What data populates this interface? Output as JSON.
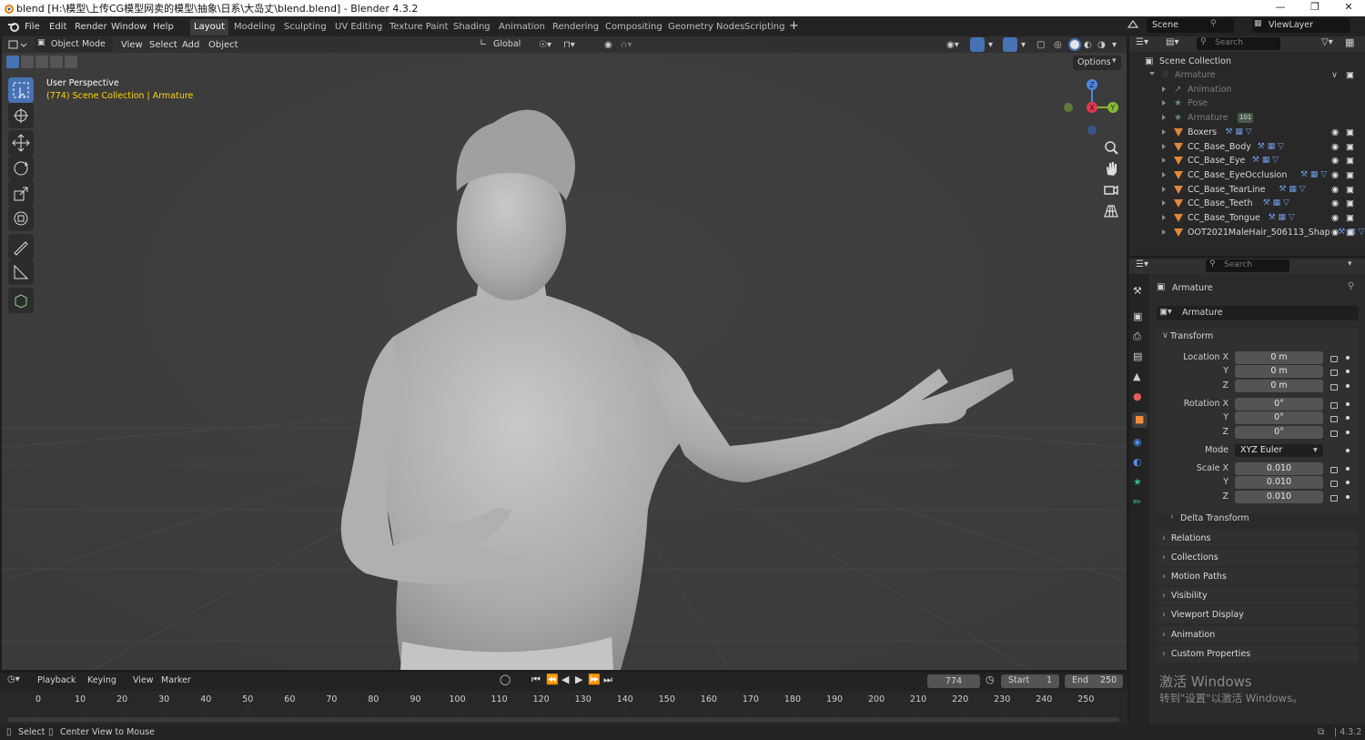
{
  "titlebar": {
    "title": "blend [H:\\模型\\上传CG模型网卖的模型\\抽象\\日系\\大岛丈\\blend.blend] - Blender 4.3.2"
  },
  "menubar": {
    "items": [
      "File",
      "Edit",
      "Render",
      "Window",
      "Help"
    ]
  },
  "workspaces": [
    "Layout",
    "Modeling",
    "Sculpting",
    "UV Editing",
    "Texture Paint",
    "Shading",
    "Animation",
    "Rendering",
    "Compositing",
    "Geometry Nodes",
    "Scripting"
  ],
  "active_workspace": "Layout",
  "scene": {
    "name": "Scene",
    "view_layer": "ViewLayer"
  },
  "viewport": {
    "mode": "Object Mode",
    "menus": [
      "View",
      "Select",
      "Add",
      "Object"
    ],
    "orientation": "Global",
    "options_label": "Options",
    "overlay_title": "User Perspective",
    "overlay_sub": "(774) Scene Collection | Armature",
    "gizmo": {
      "x": "X",
      "y": "Y",
      "z": "Z"
    }
  },
  "outliner": {
    "search_placeholder": "Search",
    "root": "Scene Collection",
    "items": [
      {
        "name": "Armature",
        "level": 1,
        "kind": "armature",
        "dim": true
      },
      {
        "name": "Animation",
        "level": 2,
        "kind": "action",
        "dim": true
      },
      {
        "name": "Pose",
        "level": 2,
        "kind": "pose",
        "dim": true
      },
      {
        "name": "Armature",
        "level": 2,
        "kind": "armdata",
        "dim": true,
        "badge": "101"
      },
      {
        "name": "Boxers",
        "level": 2,
        "kind": "mesh",
        "dim": false
      },
      {
        "name": "CC_Base_Body",
        "level": 2,
        "kind": "mesh",
        "dim": false
      },
      {
        "name": "CC_Base_Eye",
        "level": 2,
        "kind": "mesh",
        "dim": false
      },
      {
        "name": "CC_Base_EyeOcclusion",
        "level": 2,
        "kind": "mesh",
        "dim": false
      },
      {
        "name": "CC_Base_TearLine",
        "level": 2,
        "kind": "mesh",
        "dim": false
      },
      {
        "name": "CC_Base_Teeth",
        "level": 2,
        "kind": "mesh",
        "dim": false
      },
      {
        "name": "CC_Base_Tongue",
        "level": 2,
        "kind": "mesh",
        "dim": false
      },
      {
        "name": "OOT2021MaleHair_506113_Shap",
        "level": 2,
        "kind": "mesh",
        "dim": false
      }
    ]
  },
  "properties": {
    "search_placeholder": "Search",
    "object_name": "Armature",
    "datablock_name": "Armature",
    "transform_label": "Transform",
    "location": {
      "label": "Location X",
      "x": "0 m",
      "y": "0 m",
      "z": "0 m"
    },
    "rotation": {
      "label": "Rotation X",
      "x": "0°",
      "y": "0°",
      "z": "0°"
    },
    "mode_label": "Mode",
    "mode_value": "XYZ Euler",
    "scale": {
      "label": "Scale X",
      "x": "0.010",
      "y": "0.010",
      "z": "0.010"
    },
    "axis_y": "Y",
    "axis_z": "Z",
    "delta_transform": "Delta Transform",
    "panels": [
      "Relations",
      "Collections",
      "Motion Paths",
      "Visibility",
      "Viewport Display",
      "Animation",
      "Custom Properties"
    ]
  },
  "activation": {
    "line1": "激活 Windows",
    "line2": "转到\"设置\"以激活 Windows。"
  },
  "timeline": {
    "menus": [
      "Playback",
      "Keying",
      "View",
      "Marker"
    ],
    "current_frame": "774",
    "start_label": "Start",
    "start": "1",
    "end_label": "End",
    "end": "250",
    "ticks": [
      "0",
      "10",
      "20",
      "30",
      "40",
      "50",
      "60",
      "70",
      "80",
      "90",
      "100",
      "110",
      "120",
      "130",
      "140",
      "150",
      "160",
      "170",
      "180",
      "190",
      "200",
      "210",
      "220",
      "230",
      "240",
      "250"
    ]
  },
  "statusbar": {
    "select": "Select",
    "center_view": "Center View to Mouse",
    "version": "4.3.2"
  },
  "colors": {
    "accent": "#4772b3",
    "active_text": "#ffd500",
    "header_bg": "#303030",
    "viewport_bg": "#3d3d3d",
    "mesh_icon": "#e0883b"
  }
}
